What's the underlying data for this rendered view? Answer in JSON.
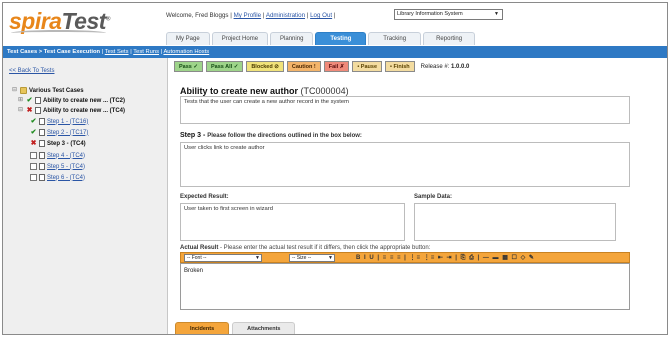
{
  "brand": {
    "logo_main": "spira",
    "logo_accent": "Test",
    "logo_tm": "®"
  },
  "header": {
    "welcome": "Welcome, Fred Bloggs",
    "sep": "|",
    "my_profile": "My Profile",
    "administration": "Administration",
    "log_out": "Log Out",
    "project": "Library Information System"
  },
  "tabs": [
    "My Page",
    "Project Home",
    "Planning",
    "Testing",
    "Tracking",
    "Reporting"
  ],
  "active_tab": "Testing",
  "bluebar": {
    "crumb": "Test Cases > Test Case Execution",
    "sep": "|",
    "test_sets": "Test Sets",
    "test_runs": "Test Runs",
    "automation_hosts": "Automation Hosts"
  },
  "left": {
    "back": "<< Back To Tests",
    "tree": {
      "root": "Various Test Cases",
      "tc2": "Ability to create new ... (TC2)",
      "tc4": "Ability to create new ... (TC4)",
      "steps": [
        "Step 1 - (TC16)",
        "Step 2 - (TC17)",
        "Step 3 - (TC4)",
        "Step 4 - (TC4)",
        "Step 5 - (TC4)",
        "Step 6 - (TC4)"
      ]
    }
  },
  "buttons": {
    "pass": "Pass ✓",
    "pass_all": "Pass All ✓",
    "blocked": "Blocked ⊘",
    "caution": "Caution !",
    "fail": "Fail ✗",
    "pause": "• Pause",
    "finish": "• Finish",
    "release_label": "Release #:",
    "release_value": "1.0.0.0"
  },
  "main": {
    "title": "Ability to create new author",
    "title_id": "(TC000004)",
    "description": "Tests that the user can create a new author record in the system",
    "step_title": "Step 3 -",
    "step_sub": "Please follow the directions outlined in the box below:",
    "step_text": "User clicks link to create author",
    "expected_label": "Expected Result:",
    "expected_text": "User taken to first screen in wizard",
    "sample_label": "Sample Data:",
    "actual_label": "Actual Result",
    "actual_sub": "- Please enter the actual test result if it differs, then click the appropriate button:",
    "font_dd": "-- Font --",
    "size_dd": "-- Size --",
    "tools": "B I U | ≡ ≡ ≡ | ⋮≡ ⋮≡ ⇤ ⇥ | ⎘ ⎙ | — ▬ ▦ ☐ ◇ ✎",
    "actual_text": "Broken"
  },
  "bottom_tabs": [
    "Incidents",
    "Attachments"
  ]
}
